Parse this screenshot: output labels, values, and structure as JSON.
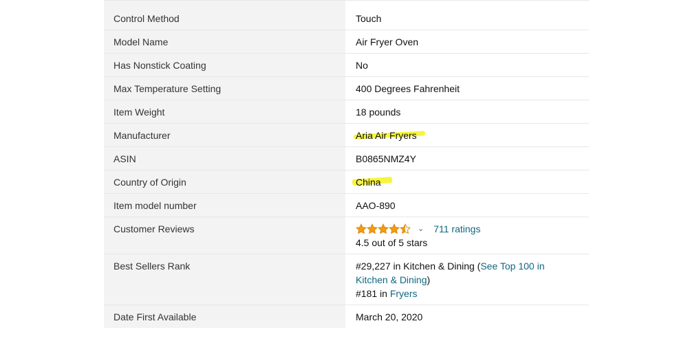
{
  "specs": {
    "rows": [
      {
        "label": "Control Method",
        "value": "Touch"
      },
      {
        "label": "Model Name",
        "value": "Air Fryer Oven"
      },
      {
        "label": "Has Nonstick Coating",
        "value": "No"
      },
      {
        "label": "Max Temperature Setting",
        "value": "400 Degrees Fahrenheit"
      },
      {
        "label": "Item Weight",
        "value": "18 pounds"
      },
      {
        "label": "Manufacturer",
        "value": "Aria Air Fryers"
      },
      {
        "label": "ASIN",
        "value": "B0865NMZ4Y"
      },
      {
        "label": "Country of Origin",
        "value": "China"
      },
      {
        "label": "Item model number",
        "value": "AAO-890"
      },
      {
        "label": "Customer Reviews"
      },
      {
        "label": "Best Sellers Rank"
      },
      {
        "label": "Date First Available",
        "value": "March 20, 2020"
      }
    ],
    "reviews": {
      "rating": 4.5,
      "ratings_link": "711 ratings",
      "rating_text": "4.5 out of 5 stars"
    },
    "rank": {
      "primary_rank": "#29,227 in Kitchen & Dining (",
      "see_top_link_part1": "See Top 100 in",
      "see_top_link_part2": "Kitchen & Dining",
      "close_paren": ")",
      "secondary_rank": "#181 in ",
      "secondary_link": "Fryers"
    }
  },
  "colors": {
    "highlight": "#f4f31a",
    "star": "#f39c12",
    "link": "#0f6680"
  }
}
